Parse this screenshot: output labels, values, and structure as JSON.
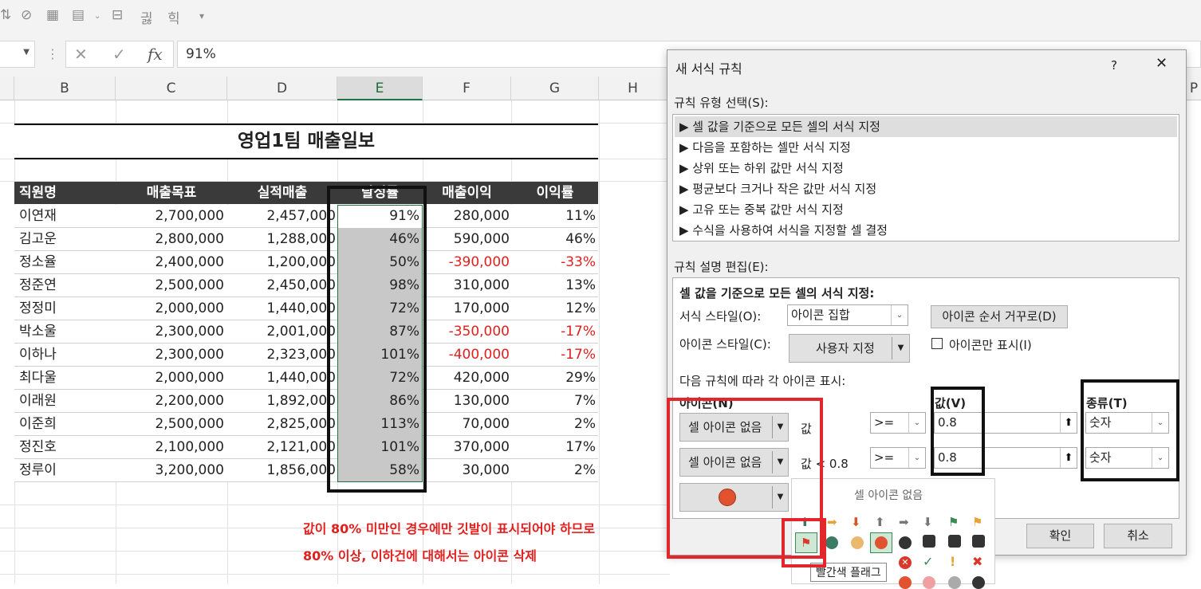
{
  "formula_bar": {
    "value": "91%",
    "fx": "fx"
  },
  "columns": [
    "B",
    "C",
    "D",
    "E",
    "F",
    "G",
    "H",
    "P"
  ],
  "sheet": {
    "title": "영업1팀 매출일보",
    "headers": [
      "직원명",
      "매출목표",
      "실적매출",
      "달성률",
      "매출이익",
      "이익률"
    ],
    "rows": [
      [
        "이연재",
        "2,700,000",
        "2,457,000",
        "91%",
        "280,000",
        "11%"
      ],
      [
        "김고운",
        "2,800,000",
        "1,288,000",
        "46%",
        "590,000",
        "46%"
      ],
      [
        "정소율",
        "2,400,000",
        "1,200,000",
        "50%",
        "-390,000",
        "-33%"
      ],
      [
        "정준연",
        "2,500,000",
        "2,450,000",
        "98%",
        "310,000",
        "13%"
      ],
      [
        "정정미",
        "2,000,000",
        "1,440,000",
        "72%",
        "170,000",
        "12%"
      ],
      [
        "박소울",
        "2,300,000",
        "2,001,000",
        "87%",
        "-350,000",
        "-17%"
      ],
      [
        "이하나",
        "2,300,000",
        "2,323,000",
        "101%",
        "-400,000",
        "-17%"
      ],
      [
        "최다울",
        "2,000,000",
        "1,440,000",
        "72%",
        "420,000",
        "29%"
      ],
      [
        "이래원",
        "2,200,000",
        "1,892,000",
        "86%",
        "130,000",
        "7%"
      ],
      [
        "이준희",
        "2,500,000",
        "2,825,000",
        "113%",
        "70,000",
        "2%"
      ],
      [
        "정진호",
        "2,100,000",
        "2,121,000",
        "101%",
        "370,000",
        "17%"
      ],
      [
        "정루이",
        "3,200,000",
        "1,856,000",
        "58%",
        "30,000",
        "2%"
      ]
    ]
  },
  "note": {
    "line1": "값이 80% 미만인 경우에만 깃발이 표시되어야 하므로",
    "line2": "80% 이상, 이하건에 대해서는 아이콘 삭제"
  },
  "dialog": {
    "title": "새 서식 규칙",
    "help": "?",
    "close": "✕",
    "rule_type_label": "규칙 유형 선택(S):",
    "rule_types": [
      "▶ 셀 값을 기준으로 모든 셀의 서식 지정",
      "▶ 다음을 포함하는 셀만 서식 지정",
      "▶ 상위 또는 하위 값만 서식 지정",
      "▶ 평균보다 크거나 작은 값만 서식 지정",
      "▶ 고유 또는 중복 값만 서식 지정",
      "▶ 수식을 사용하여 서식을 지정할 셀 결정"
    ],
    "edit_label": "규칙 설명 편집(E):",
    "desc_heading": "셀 값을 기준으로 모든 셀의 서식 지정:",
    "format_style_label": "서식 스타일(O):",
    "format_style_value": "아이콘 집합",
    "reverse_button": "아이콘 순서 거꾸로(D)",
    "icon_style_label": "아이콘 스타일(C):",
    "icon_style_value": "사용자 지정",
    "icon_only_label": "아이콘만 표시(I)",
    "rules_caption": "다음 규칙에 따라 각 아이콘 표시:",
    "icon_col": "아이콘(N)",
    "value_col": "값(V)",
    "type_col": "종류(T)",
    "row1": {
      "icon": "셀 아이콘 없음",
      "cond": "값",
      "op": ">=",
      "value": "0.8",
      "type": "숫자"
    },
    "row2": {
      "icon": "셀 아이콘 없음",
      "cond": "값 < 0.8",
      "op": ">=",
      "value": "0.8",
      "type": "숫자"
    },
    "ok": "확인",
    "cancel": "취소"
  },
  "popup": {
    "title": "셀 아이콘 없음",
    "tooltip": "빨간색 플래그"
  }
}
